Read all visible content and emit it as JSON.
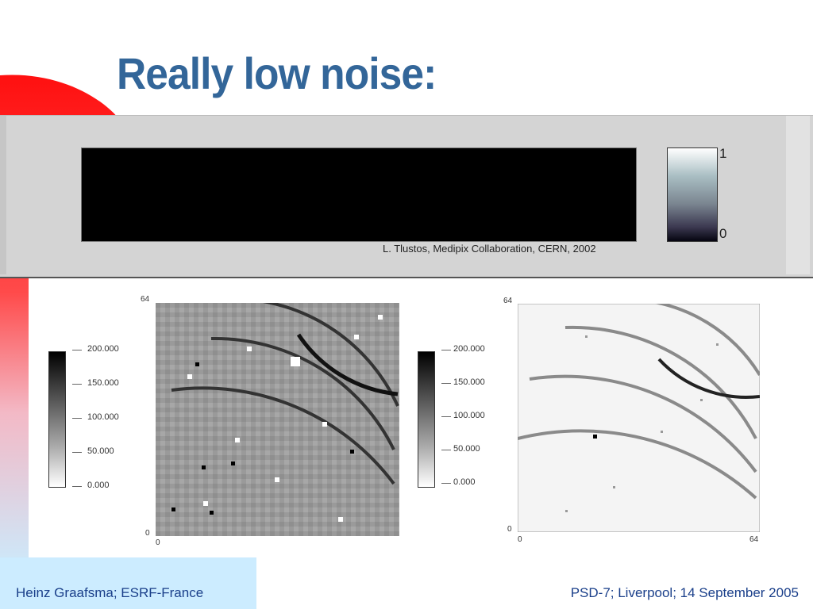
{
  "slide": {
    "title": "Really low noise:",
    "footer_left": "Heinz Graafsma; ESRF-France",
    "footer_right": "PSD-7; Liverpool; 14 September 2005"
  },
  "banner": {
    "credit": "L. Tlustos, Medipix Collaboration, CERN, 2002",
    "colorbar_max": "1",
    "colorbar_min": "0"
  },
  "images": {
    "left_legend_ticks": [
      "200.000",
      "150.000",
      "100.000",
      "50.000",
      "0.000"
    ],
    "right_legend_ticks": [
      "200.000",
      "150.000",
      "100.000",
      "50.000",
      "0.000"
    ],
    "left_axis": {
      "y_max": "64",
      "y_min": "0",
      "x_min": "0"
    },
    "right_axis": {
      "y_max": "64",
      "y_min": "0",
      "x_min": "0",
      "x_max": "64"
    }
  },
  "colors": {
    "title": "#336699",
    "footer_text": "#1a3f8a",
    "deco_red": "#ff1a1a"
  }
}
